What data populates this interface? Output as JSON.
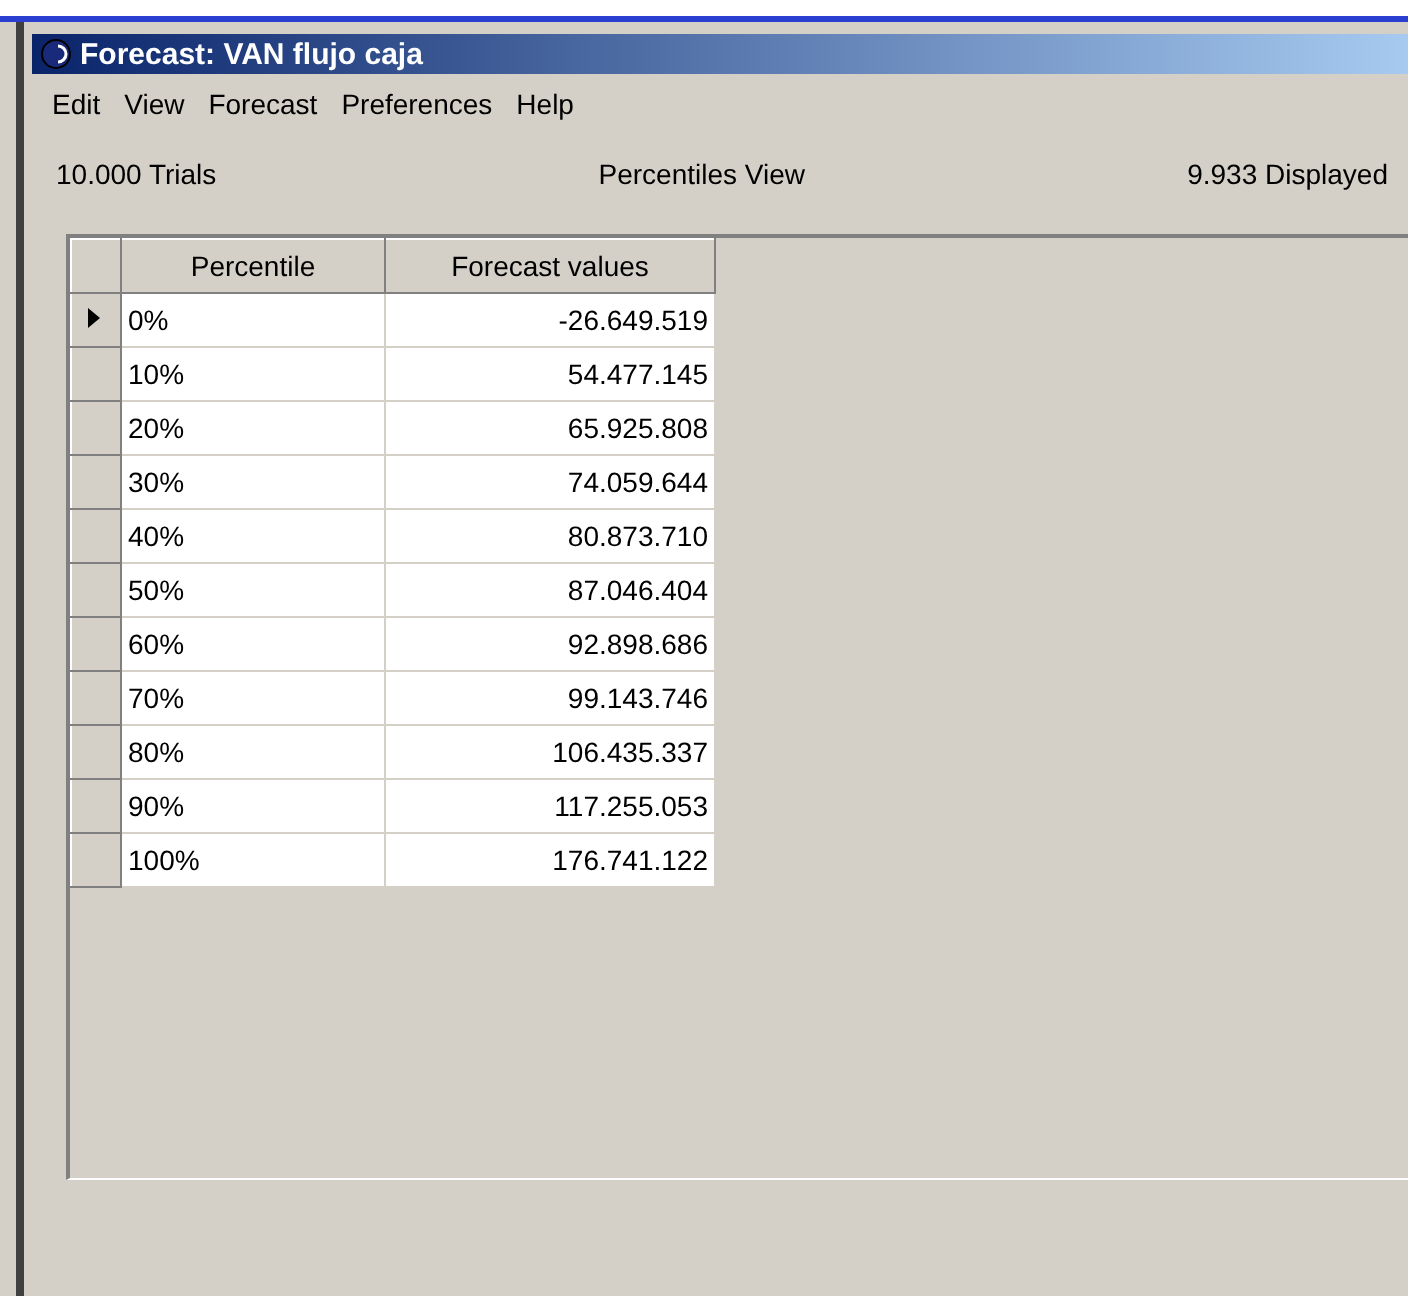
{
  "window": {
    "title": "Forecast: VAN flujo caja"
  },
  "menu": [
    "Edit",
    "View",
    "Forecast",
    "Preferences",
    "Help"
  ],
  "info": {
    "trials": "10.000 Trials",
    "view": "Percentiles View",
    "displayed": "9.933 Displayed"
  },
  "table": {
    "columns": [
      "Percentile",
      "Forecast values"
    ],
    "rows": [
      {
        "percentile": "0%",
        "value": "-26.649.519",
        "selected": true
      },
      {
        "percentile": "10%",
        "value": "54.477.145",
        "selected": false
      },
      {
        "percentile": "20%",
        "value": "65.925.808",
        "selected": false
      },
      {
        "percentile": "30%",
        "value": "74.059.644",
        "selected": false
      },
      {
        "percentile": "40%",
        "value": "80.873.710",
        "selected": false
      },
      {
        "percentile": "50%",
        "value": "87.046.404",
        "selected": false
      },
      {
        "percentile": "60%",
        "value": "92.898.686",
        "selected": false
      },
      {
        "percentile": "70%",
        "value": "99.143.746",
        "selected": false
      },
      {
        "percentile": "80%",
        "value": "106.435.337",
        "selected": false
      },
      {
        "percentile": "90%",
        "value": "117.255.053",
        "selected": false
      },
      {
        "percentile": "100%",
        "value": "176.741.122",
        "selected": false
      }
    ]
  }
}
